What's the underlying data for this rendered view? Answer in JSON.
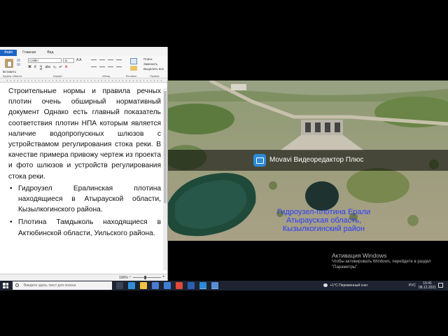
{
  "wordpad": {
    "tabs": [
      "Файл",
      "Главная",
      "Вид"
    ],
    "ribbon": {
      "paste_label": "Вставить",
      "font_name": "Calibri",
      "font_size": "11",
      "format_buttons": [
        "Ж",
        "К",
        "Ч",
        "abc",
        "x₂",
        "x²",
        "A"
      ],
      "edit_items": [
        "Поиск",
        "Заменить",
        "Выделить все"
      ],
      "groups": [
        "Буфер обмена",
        "Шрифт",
        "Абзац",
        "Вставка",
        "Правка"
      ]
    },
    "document": {
      "paragraph": "Строительные нормы и правила речных плотин очень обширный нормативный документ Однако есть главный показатель соответствия плотин НПА которым является наличие водопропускных шлюзов с устройствамом регулирования стока реки. В качестве примера привожу чертеж из проекта и фото шлюзов и устройств регулирования стока реки.",
      "bullets": [
        "Гидроузел Ералинская плотина находящиеся в Атырауской области, Кызылкогинского района.",
        "Плотина Тамдыколь находящиеся в Актюбинской области, Уильского района."
      ]
    },
    "status": {
      "zoom": "100%",
      "zoom_minus": "−",
      "zoom_plus": "+"
    }
  },
  "video": {
    "watermark": "Movavi Видеоредактор Плюс",
    "caption_lines": [
      "Гидроузел-плотина Ерали",
      "Атырауская область,",
      "Кызылкогинский район"
    ]
  },
  "activation": {
    "title": "Активация Windows",
    "subtitle": "Чтобы активировать Windows, перейдите в раздел \"Параметры\"."
  },
  "taskbar": {
    "search_placeholder": "Введите здесь текст для поиска",
    "weather": "+1°C  Переменный снег",
    "language": "РУС",
    "time": "15:41",
    "date": "08.12.2021",
    "apps": [
      {
        "icon": "task-view-icon",
        "color": "#3a4256"
      },
      {
        "icon": "edge-icon",
        "color": "#2f8fd6"
      },
      {
        "icon": "file-explorer-icon",
        "color": "#f0c341"
      },
      {
        "icon": "store-icon",
        "color": "#4b7bd1"
      },
      {
        "icon": "mail-icon",
        "color": "#3c7fd6"
      },
      {
        "icon": "chrome-icon",
        "color": "#e0493b"
      },
      {
        "icon": "word-icon",
        "color": "#2b5fb4"
      },
      {
        "icon": "movavi-icon",
        "color": "#2d8ad6"
      },
      {
        "icon": "wordpad-icon",
        "color": "#5a8fd8"
      }
    ]
  }
}
